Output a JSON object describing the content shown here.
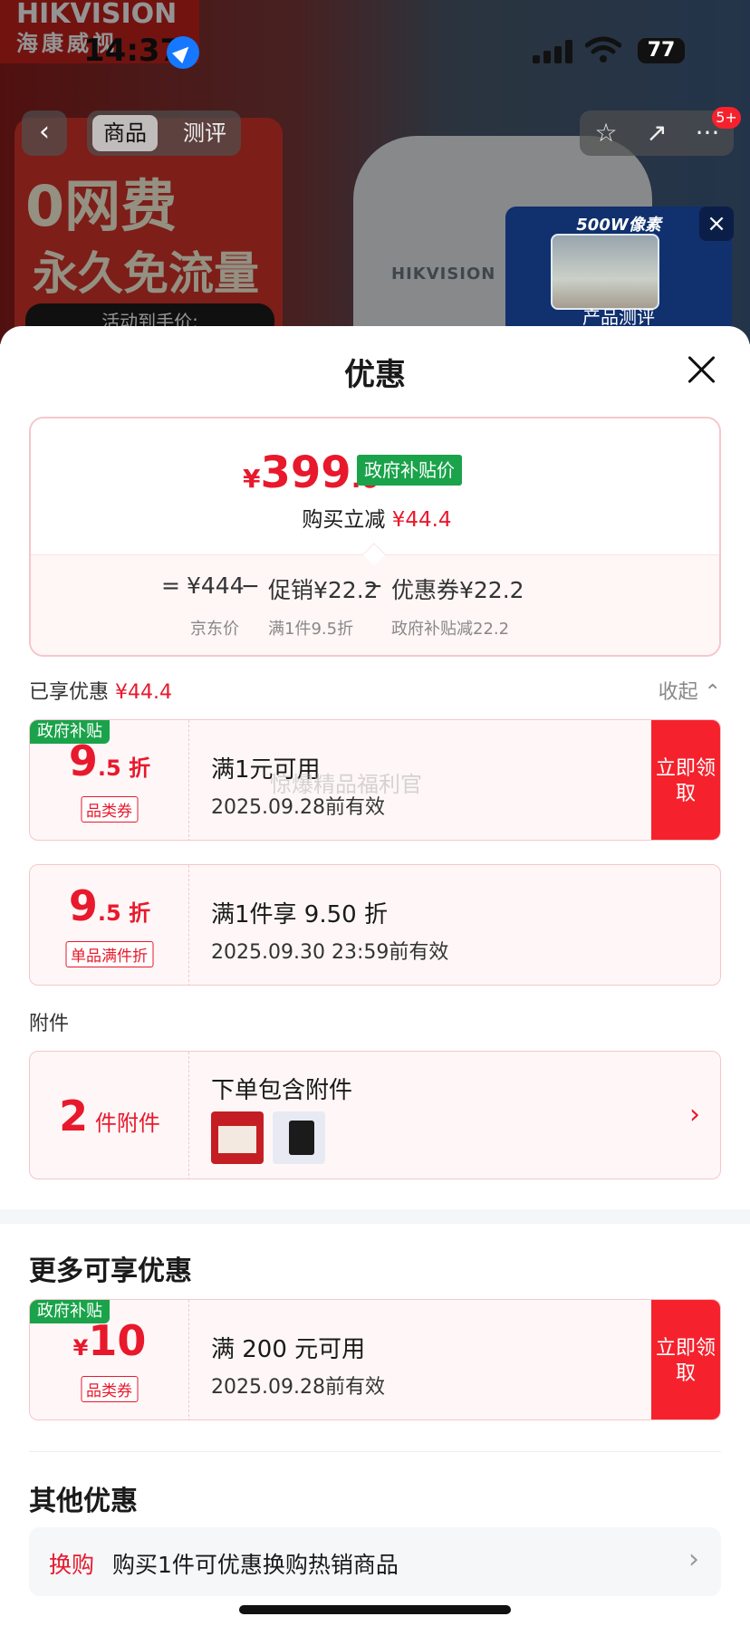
{
  "status_bar": {
    "time": "14:37",
    "battery": "77"
  },
  "backdrop": {
    "brand_en": "HIKVISION",
    "brand_cn": "海康威视",
    "promo_big": "0网费",
    "promo_sub": "永久免流量",
    "promo_strip": "活动到手价:",
    "camera_brand": "HIKVISION"
  },
  "nav": {
    "tab_product": "商品",
    "tab_review": "测评",
    "badge": "5+"
  },
  "video": {
    "title": "500W像素",
    "caption": "产品测评"
  },
  "sheet": {
    "title": "优惠",
    "price": {
      "yen": "¥",
      "int": "399",
      "dec": ".6",
      "tag": "政府补贴价",
      "save_label": "购买立减",
      "save_amount": "¥44.4"
    },
    "formula": {
      "eq": "=",
      "base": "¥444",
      "base_sub": "京东价",
      "minus1": "−",
      "promo": "促销¥22.2",
      "promo_sub": "满1件9.5折",
      "minus2": "−",
      "coupon": "优惠券¥22.2",
      "coupon_sub": "政府补贴减22.2"
    },
    "enjoyed": {
      "label": "已享优惠",
      "amount": "¥44.4",
      "collapse": "收起 ⌃"
    },
    "watermark": "惊爆精品福利官",
    "coupons": [
      {
        "gov": "政府补贴",
        "big": "9",
        "small": ".5 折",
        "type": "品类券",
        "cond": "满1元可用",
        "date": "2025.09.28前有效",
        "claim": "立即领取"
      },
      {
        "big": "9",
        "small": ".5 折",
        "type": "单品满件折",
        "cond": "满1件享 9.50 折",
        "date": "2025.09.30 23:59前有效"
      }
    ],
    "attachments": {
      "label": "附件",
      "big": "2",
      "small": " 件附件",
      "title": "下单包含附件",
      "arrow": "›"
    },
    "more": {
      "title": "更多可享优惠",
      "coupon": {
        "gov": "政府补贴",
        "yen": "¥",
        "big": "10",
        "type": "品类券",
        "cond": "满 200 元可用",
        "date": "2025.09.28前有效",
        "claim": "立即领取"
      }
    },
    "other": {
      "title": "其他优惠",
      "items": [
        {
          "tag": "换购",
          "text": "购买1件可优惠换购热销商品",
          "arrow": "›"
        }
      ]
    }
  }
}
